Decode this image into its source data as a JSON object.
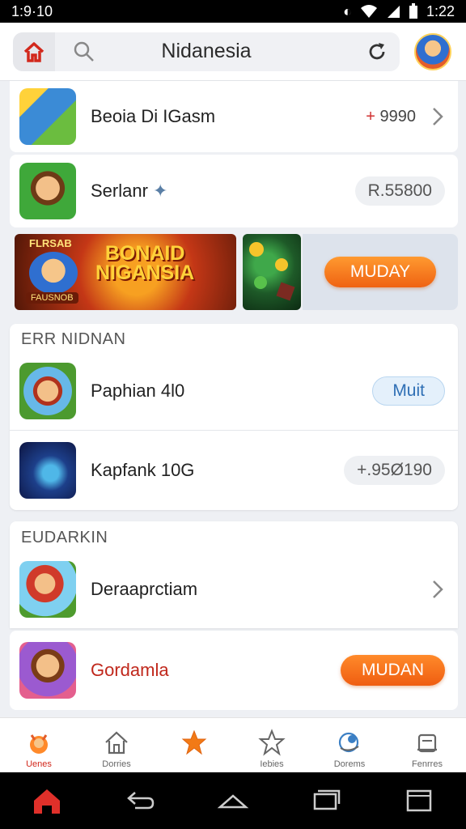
{
  "status_bar": {
    "left": "1:9·10",
    "time": "1:22"
  },
  "header": {
    "title": "Nidanesia"
  },
  "top_rows": [
    {
      "name": "Beoia Di IGasm",
      "price": "9990",
      "price_prefix": "+"
    },
    {
      "name": "Serlanr",
      "pill": "R.55800"
    }
  ],
  "banner": {
    "tag": "FLRSAB",
    "title_line1": "BONAID",
    "title_line2": "NIGANSIA",
    "sub": "FAUSNOB",
    "cta": "MUDAY"
  },
  "sections": [
    {
      "title": "ERR NIDNAN",
      "rows": [
        {
          "name": "Paphian 4l0",
          "pill": "Muit"
        },
        {
          "name": "Kapfank 10G",
          "pill": "+.95Ø190"
        }
      ]
    },
    {
      "title": "EUDARKIN",
      "rows": [
        {
          "name": "Deraaprctiam"
        },
        {
          "name": "Gordamla",
          "button": "MUDAN"
        }
      ]
    }
  ],
  "bottom_nav": [
    {
      "label": "Uenes",
      "icon": "mascot-icon"
    },
    {
      "label": "Dorries",
      "icon": "house-icon"
    },
    {
      "label": "",
      "icon": "star-filled-icon"
    },
    {
      "label": "Iebies",
      "icon": "star-outline-icon"
    },
    {
      "label": "Dorems",
      "icon": "globe-icon"
    },
    {
      "label": "Fenrres",
      "icon": "bag-icon"
    }
  ],
  "colors": {
    "accent": "#ef5d11",
    "brand_red": "#d2281c",
    "link_blue": "#2f6fb5"
  }
}
